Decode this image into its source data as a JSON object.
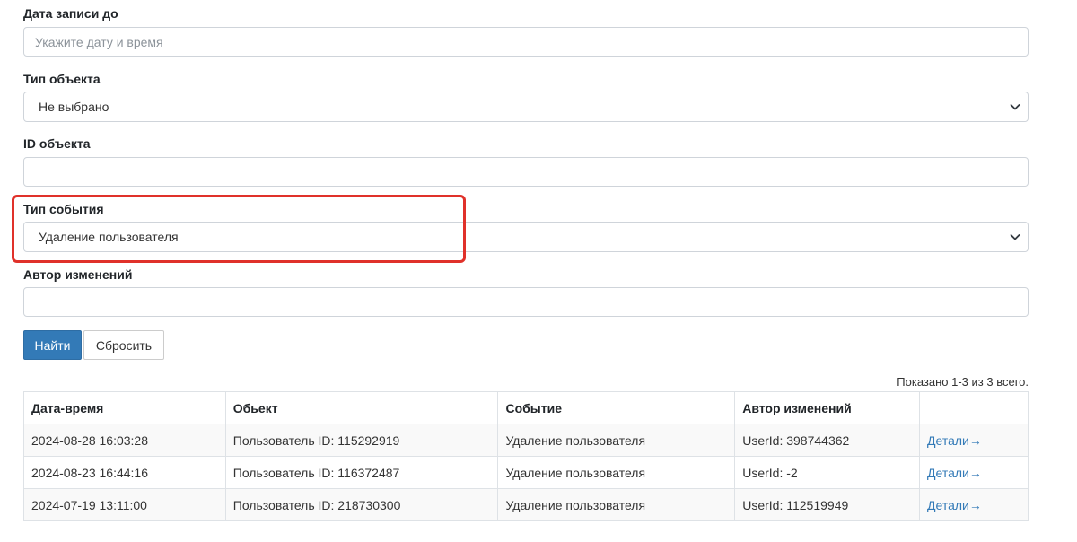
{
  "filters": {
    "date_to": {
      "label": "Дата записи до",
      "value": "",
      "placeholder": "Укажите дату и время"
    },
    "object_type": {
      "label": "Тип объекта",
      "selected": "Не выбрано"
    },
    "object_id": {
      "label": "ID объекта",
      "value": ""
    },
    "event_type": {
      "label": "Тип события",
      "selected": "Удаление пользователя"
    },
    "author": {
      "label": "Автор изменений",
      "value": ""
    }
  },
  "buttons": {
    "find": "Найти",
    "reset": "Сбросить"
  },
  "summary": "Показано 1-3 из 3 всего.",
  "table": {
    "headers": [
      "Дата-время",
      "Обьект",
      "Событие",
      "Автор изменений",
      ""
    ],
    "rows": [
      {
        "datetime": "2024-08-28 16:03:28",
        "object": "Пользователь ID: 115292919",
        "event": "Удаление пользователя",
        "author": "UserId: 398744362",
        "details": "Детали→"
      },
      {
        "datetime": "2024-08-23 16:44:16",
        "object": "Пользователь ID: 116372487",
        "event": "Удаление пользователя",
        "author": "UserId: -2",
        "details": "Детали→"
      },
      {
        "datetime": "2024-07-19 13:11:00",
        "object": "Пользователь ID: 218730300",
        "event": "Удаление пользователя",
        "author": "UserId: 112519949",
        "details": "Детали→"
      }
    ]
  },
  "colors": {
    "primary": "#337ab7",
    "highlight": "#e0312a"
  },
  "icons": {
    "select_chevron": "chevron-down-icon"
  }
}
